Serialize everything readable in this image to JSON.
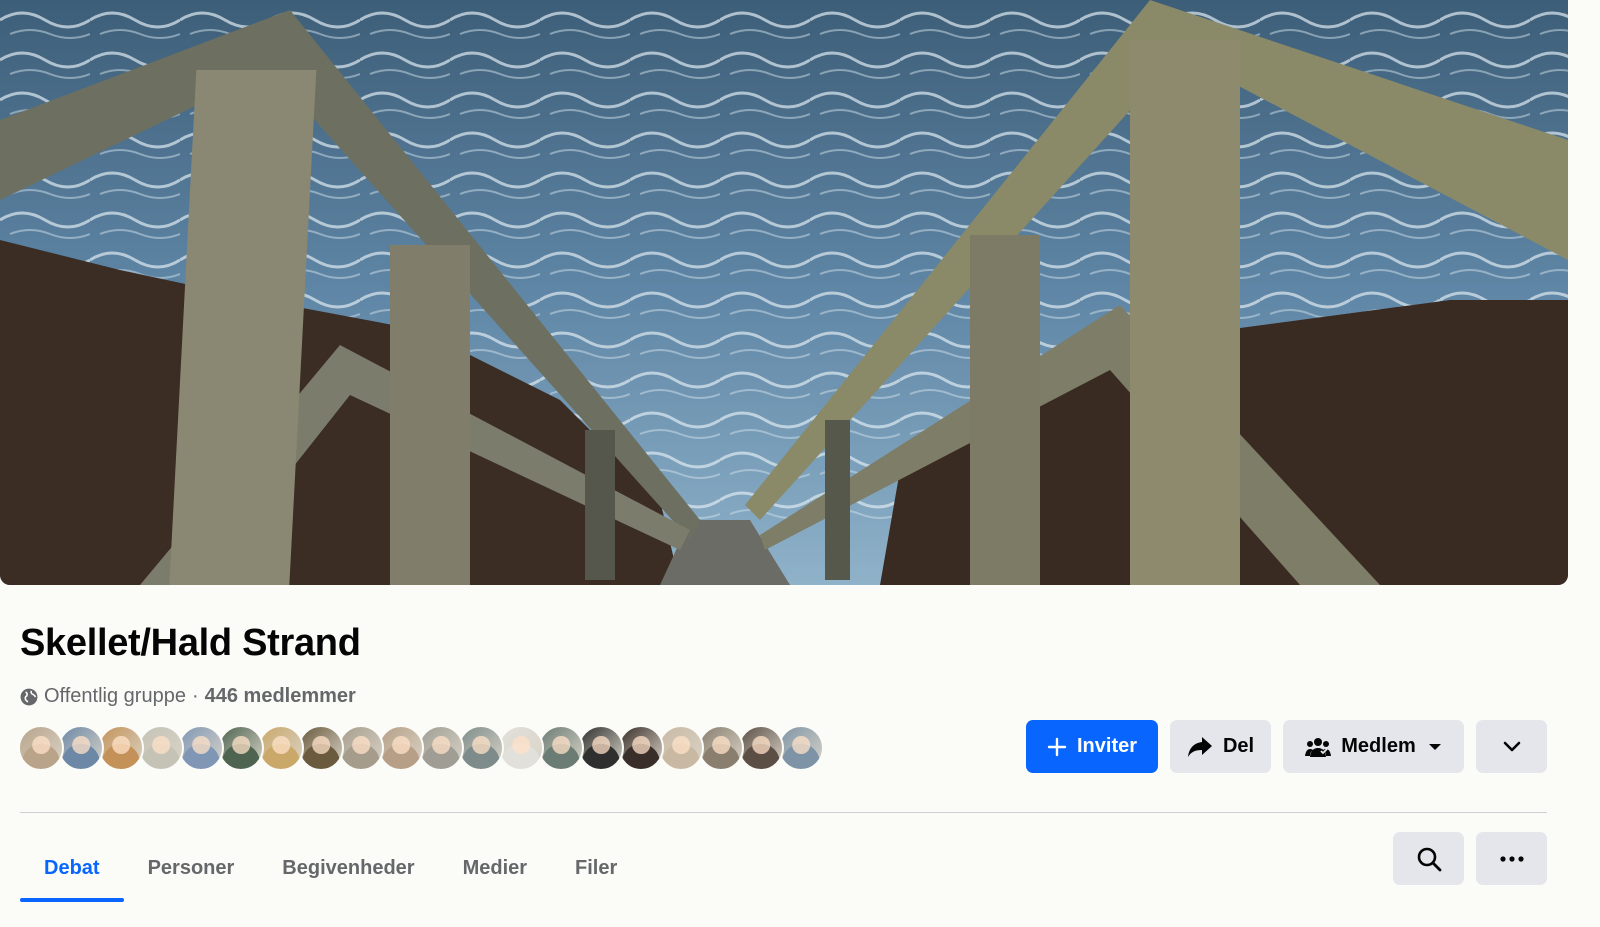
{
  "group": {
    "name": "Skellet/Hald Strand",
    "privacy": "Offentlig gruppe",
    "separator": "·",
    "members": "446 medlemmer"
  },
  "member_avatars": [
    {
      "color": "#b9a48a"
    },
    {
      "color": "#6c88a6"
    },
    {
      "color": "#c49258"
    },
    {
      "color": "#c5c2b6"
    },
    {
      "color": "#7f97b5"
    },
    {
      "color": "#4e6451"
    },
    {
      "color": "#caa86a"
    },
    {
      "color": "#6a5a3e"
    },
    {
      "color": "#a69c8c"
    },
    {
      "color": "#b69f86"
    },
    {
      "color": "#9f9d94"
    },
    {
      "color": "#7d8c8a"
    },
    {
      "color": "#e2e0da"
    },
    {
      "color": "#6b7c74"
    },
    {
      "color": "#2f2f2f"
    },
    {
      "color": "#3a2e2a"
    },
    {
      "color": "#c9b9a3"
    },
    {
      "color": "#8a7f6f"
    },
    {
      "color": "#5b4e45"
    },
    {
      "color": "#7e94a6"
    }
  ],
  "actions": {
    "invite": "Inviter",
    "share": "Del",
    "member": "Medlem"
  },
  "tabs": [
    {
      "label": "Debat",
      "active": true
    },
    {
      "label": "Personer",
      "active": false
    },
    {
      "label": "Begivenheder",
      "active": false
    },
    {
      "label": "Medier",
      "active": false
    },
    {
      "label": "Filer",
      "active": false
    }
  ],
  "colors": {
    "accent": "#0866ff",
    "secondary_button": "#e4e6eb",
    "muted_text": "#65676b",
    "background": "#fbfbf7"
  },
  "icons": {
    "privacy": "globe-icon",
    "invite": "plus-icon",
    "share": "share-arrow-icon",
    "member": "people-icon",
    "member_caret": "caret-down-icon",
    "more": "chevron-down-icon",
    "search": "search-icon",
    "overflow": "more-dots-icon"
  }
}
